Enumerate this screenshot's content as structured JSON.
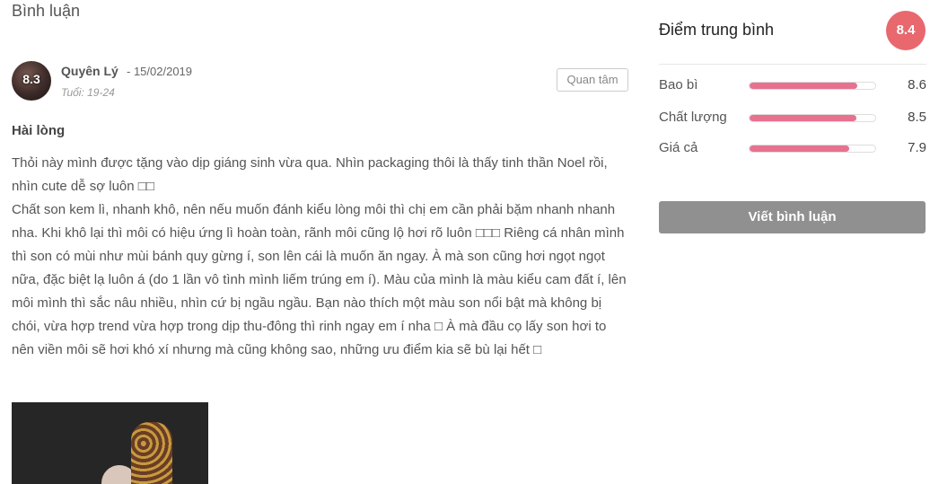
{
  "section": {
    "title": "Bình luận"
  },
  "review": {
    "user": {
      "name": "Quyên Lý",
      "date": "- 15/02/2019",
      "age": "Tuổi: 19-24",
      "score": "8.3"
    },
    "follow_label": "Quan tâm",
    "heading": "Hài lòng",
    "paragraphs": [
      "Thỏi này mình được tặng vào dịp giáng sinh vừa qua. Nhìn packaging thôi là thấy tinh thần Noel rồi, nhìn cute dễ sợ luôn □□",
      "Chất son kem lì, nhanh khô, nên nếu muốn đánh kiểu lòng môi thì chị em cần phải bặm nhanh nhanh nha. Khi khô lại thì môi có hiệu ứng lì hoàn toàn, rãnh môi cũng lộ hơi rõ luôn □□□ Riêng cá nhân mình thì son có mùi như mùi bánh quy gừng í, son lên cái là muốn ăn ngay. À mà son cũng hơi ngọt ngọt nữa, đặc biệt lạ luôn á (do 1 lần vô tình mình liếm trúng em í). Màu của mình là màu kiểu cam đất í, lên môi mình thì sắc nâu nhiều, nhìn cứ bị ngầu ngầu. Bạn nào thích một màu son nổi bật mà không bị chói, vừa hợp trend vừa hợp trong dịp thu-đông thì rinh ngay em í nha □ À mà đầu cọ lấy son hơi to nên viền môi sẽ hơi khó xí nhưng mà cũng không sao, những ưu điểm kia sẽ bù lại hết □"
    ]
  },
  "sidebar": {
    "title": "Điểm trung bình",
    "average": "8.4",
    "ratings": [
      {
        "label": "Bao bì",
        "value": "8.6",
        "fill_fraction": 0.86
      },
      {
        "label": "Chất lượng",
        "value": "8.5",
        "fill_fraction": 0.85
      },
      {
        "label": "Giá cả",
        "value": "7.9",
        "fill_fraction": 0.79
      }
    ],
    "write_button": "Viết bình luận"
  },
  "colors": {
    "accent": "#e8686e",
    "bar": "#e8718f",
    "button": "#909090"
  }
}
